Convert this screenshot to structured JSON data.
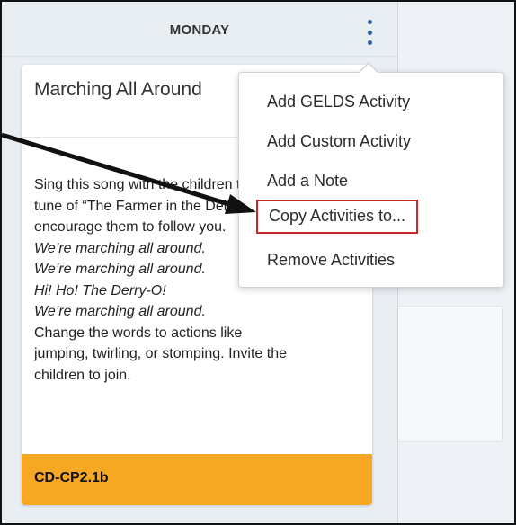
{
  "header": {
    "day": "MONDAY"
  },
  "card": {
    "title": "Marching All Around",
    "body_lines": [
      "Sing this song with the children to the",
      "tune of “The Farmer in the Dell.”",
      "encourage them to follow you."
    ],
    "lyrics": [
      "We’re marching all around.",
      "We’re marching all around.",
      "Hi! Ho! The Derry-O!",
      "We’re marching all around."
    ],
    "closing_lines": [
      "Change the words to actions like",
      "jumping, twirling, or stomping. Invite the",
      "children to join."
    ],
    "code": "CD-CP2.1b",
    "code_color": "#f7a823"
  },
  "menu": {
    "items": [
      "Add GELDS Activity",
      "Add Custom Activity",
      "Add a Note",
      "Copy Activities to...",
      "Remove Activities"
    ],
    "highlight_color": "#c8262b"
  },
  "icons": {
    "kebab": "more-vertical-icon",
    "arrow": "pointer-arrow-icon"
  },
  "accent_color": "#2a62a8"
}
